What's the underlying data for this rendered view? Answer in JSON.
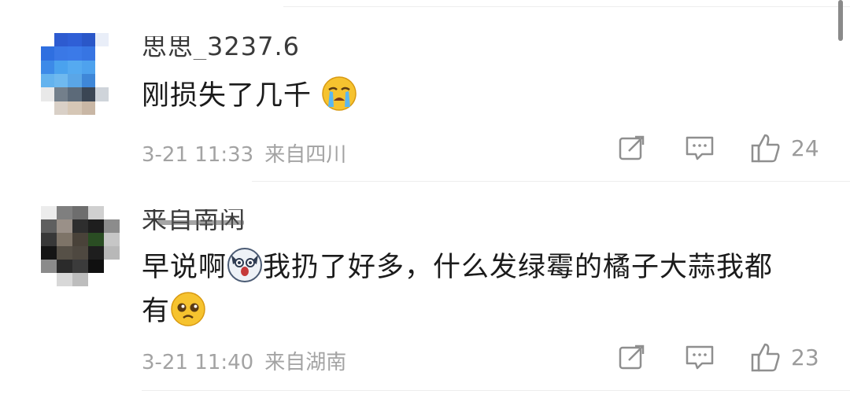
{
  "comments": [
    {
      "username": "思思_3237.6",
      "text": "刚损失了几千",
      "emoji": "crying-face-emoji",
      "date": "3-21 11:33",
      "location": "来自四川",
      "likes": "24"
    },
    {
      "username": "来自南闲",
      "text_part1": "早说啊",
      "emoji1": "shocked-dog-emoji",
      "text_part2": "我扔了好多，什么发绿霉的橘子大蒜我都",
      "text_part3": "有",
      "emoji2": "pleading-face-emoji",
      "date": "3-21 11:40",
      "location": "来自湖南",
      "likes": "23"
    }
  ],
  "colors": {
    "text": "#1b1b1b",
    "meta": "#a3a3a3",
    "icon": "#8f8f8f"
  }
}
